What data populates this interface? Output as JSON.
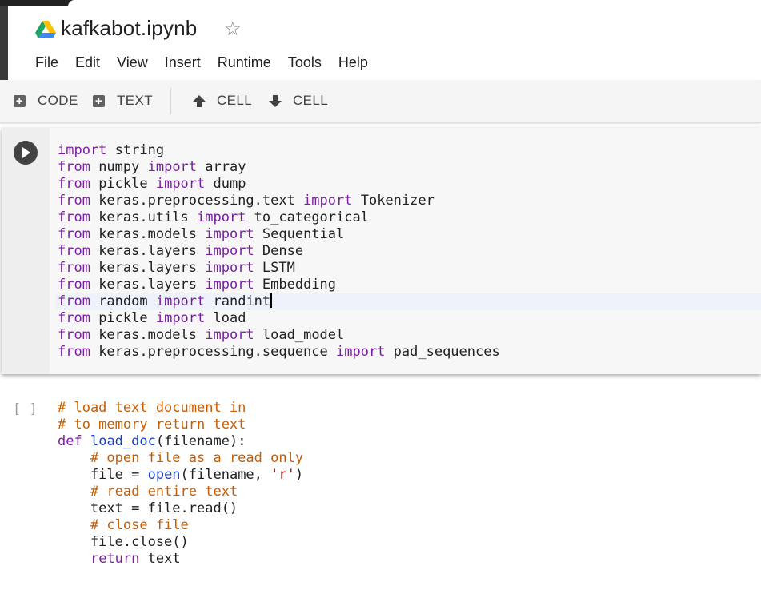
{
  "notebook": {
    "title": "kafkabot.ipynb"
  },
  "menu": [
    "File",
    "Edit",
    "View",
    "Insert",
    "Runtime",
    "Tools",
    "Help"
  ],
  "toolbar": {
    "add_code": "CODE",
    "add_text": "TEXT",
    "cell_up": "CELL",
    "cell_down": "CELL"
  },
  "cell1": {
    "lines": [
      [
        [
          "kw",
          "import"
        ],
        [
          "t",
          " string"
        ]
      ],
      [
        [
          "kw",
          "from"
        ],
        [
          "t",
          " numpy "
        ],
        [
          "kw",
          "import"
        ],
        [
          "t",
          " array"
        ]
      ],
      [
        [
          "kw",
          "from"
        ],
        [
          "t",
          " pickle "
        ],
        [
          "kw",
          "import"
        ],
        [
          "t",
          " dump"
        ]
      ],
      [
        [
          "kw",
          "from"
        ],
        [
          "t",
          " keras.preprocessing.text "
        ],
        [
          "kw",
          "import"
        ],
        [
          "t",
          " Tokenizer"
        ]
      ],
      [
        [
          "kw",
          "from"
        ],
        [
          "t",
          " keras.utils "
        ],
        [
          "kw",
          "import"
        ],
        [
          "t",
          " to_categorical"
        ]
      ],
      [
        [
          "kw",
          "from"
        ],
        [
          "t",
          " keras.models "
        ],
        [
          "kw",
          "import"
        ],
        [
          "t",
          " Sequential"
        ]
      ],
      [
        [
          "kw",
          "from"
        ],
        [
          "t",
          " keras.layers "
        ],
        [
          "kw",
          "import"
        ],
        [
          "t",
          " Dense"
        ]
      ],
      [
        [
          "kw",
          "from"
        ],
        [
          "t",
          " keras.layers "
        ],
        [
          "kw",
          "import"
        ],
        [
          "t",
          " LSTM"
        ]
      ],
      [
        [
          "kw",
          "from"
        ],
        [
          "t",
          " keras.layers "
        ],
        [
          "kw",
          "import"
        ],
        [
          "t",
          " Embedding"
        ]
      ],
      [
        [
          "kw",
          "from"
        ],
        [
          "t",
          " random "
        ],
        [
          "kw",
          "import"
        ],
        [
          "t",
          " randint"
        ],
        [
          "cursor",
          ""
        ]
      ],
      [
        [
          "kw",
          "from"
        ],
        [
          "t",
          " pickle "
        ],
        [
          "kw",
          "import"
        ],
        [
          "t",
          " load"
        ]
      ],
      [
        [
          "kw",
          "from"
        ],
        [
          "t",
          " keras.models "
        ],
        [
          "kw",
          "import"
        ],
        [
          "t",
          " load_model"
        ]
      ],
      [
        [
          "kw",
          "from"
        ],
        [
          "t",
          " keras.preprocessing.sequence "
        ],
        [
          "kw",
          "import"
        ],
        [
          "t",
          " pad_sequences"
        ]
      ]
    ]
  },
  "cell2": {
    "bracket": "[ ]",
    "lines": [
      [
        [
          "cm",
          "# load text document in"
        ]
      ],
      [
        [
          "cm",
          "# to memory return text"
        ]
      ],
      [
        [
          "kw",
          "def"
        ],
        [
          "t",
          " "
        ],
        [
          "fn",
          "load_doc"
        ],
        [
          "t",
          "(filename):"
        ]
      ],
      [
        [
          "t",
          "    "
        ],
        [
          "cm",
          "# open file as a read only"
        ]
      ],
      [
        [
          "t",
          "    file = "
        ],
        [
          "fn",
          "open"
        ],
        [
          "t",
          "(filename, "
        ],
        [
          "st",
          "'r'"
        ],
        [
          "t",
          ")"
        ]
      ],
      [
        [
          "t",
          "    "
        ],
        [
          "cm",
          "# read entire text"
        ]
      ],
      [
        [
          "t",
          "    text = file.read()"
        ]
      ],
      [
        [
          "t",
          "    "
        ],
        [
          "cm",
          "# close file"
        ]
      ],
      [
        [
          "t",
          "    file.close()"
        ]
      ],
      [
        [
          "t",
          "    "
        ],
        [
          "kw",
          "return"
        ],
        [
          "t",
          " text"
        ]
      ]
    ]
  },
  "colors": {
    "keyword": "#7b1fa2",
    "comment": "#c65d00",
    "function": "#1a3fc6",
    "string": "#a31515"
  }
}
